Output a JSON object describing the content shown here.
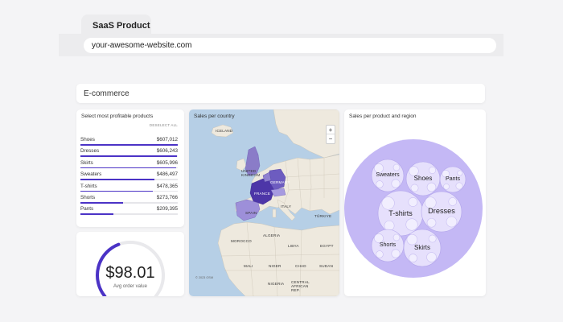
{
  "browser": {
    "tab_title": "SaaS Product",
    "url": "your-awesome-website.com"
  },
  "section": {
    "title": "E-commerce"
  },
  "products": {
    "title": "Select most profitable products",
    "deselect_label": "DESELECT ALL",
    "items": [
      {
        "name": "Shoes",
        "value": "$607,012",
        "share": 1.0
      },
      {
        "name": "Dresses",
        "value": "$606,243",
        "share": 0.99
      },
      {
        "name": "Skirts",
        "value": "$605,996",
        "share": 0.985
      },
      {
        "name": "Sweaters",
        "value": "$486,497",
        "share": 0.76
      },
      {
        "name": "T-shirts",
        "value": "$478,365",
        "share": 0.74
      },
      {
        "name": "Shorts",
        "value": "$273,766",
        "share": 0.44
      },
      {
        "name": "Pants",
        "value": "$209,395",
        "share": 0.34
      }
    ]
  },
  "gauge": {
    "value": "$98.01",
    "label": "Avg order value",
    "fill_fraction": 0.42,
    "color": "#4b33c6"
  },
  "map": {
    "title": "Sales per country",
    "zoom_in": "+",
    "zoom_out": "−",
    "credit": "© 2023 OSM",
    "labels": {
      "iceland": "ICELAND",
      "uk": "UNITED KINGDOM",
      "germany": "GERMANY",
      "france": "FRANCE",
      "spain": "SPAIN",
      "italy": "ITALY",
      "turkiye": "TÜRKIYE",
      "morocco": "MOROCCO",
      "algeria": "ALGERIA",
      "libya": "LIBYA",
      "egypt": "EGYPT",
      "mali": "MALI",
      "niger": "NIGER",
      "chad": "CHAD",
      "sudan": "SUDAN",
      "nigeria": "NIGERIA",
      "car": "CENTRAL AFRICAN REP."
    }
  },
  "bubbles": {
    "title": "Sales per product and region",
    "items": [
      {
        "name": "Sweaters"
      },
      {
        "name": "Shoes"
      },
      {
        "name": "Pants"
      },
      {
        "name": "T-shirts"
      },
      {
        "name": "Dresses"
      },
      {
        "name": "Shorts"
      },
      {
        "name": "Skirts"
      }
    ]
  },
  "colors": {
    "accent": "#4b33c6",
    "bubble_outer": "#c4b8f5",
    "bubble_inner": "#e6e0fc",
    "water": "#b6cfe6",
    "land": "#eee9de"
  }
}
